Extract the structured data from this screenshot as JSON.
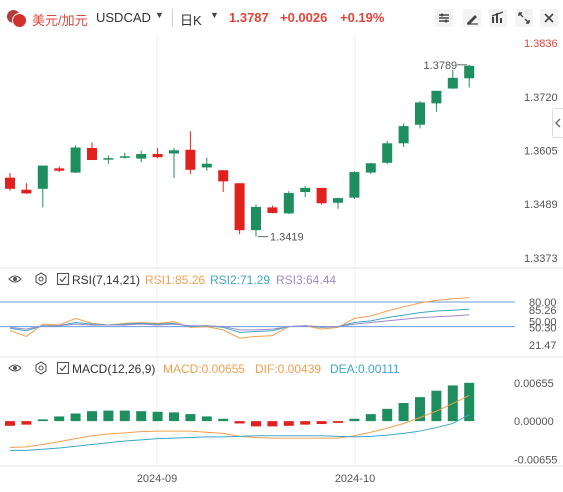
{
  "header": {
    "pair_cn": "美元/加元",
    "pair_en": "USDCAD",
    "period": "日K",
    "price": "1.3787",
    "change": "+0.0026",
    "change_pct": "+0.19%"
  },
  "colors": {
    "up": "#1e8e5e",
    "down": "#e0211e",
    "rsi1": "#f0a050",
    "rsi2": "#3aa8c8",
    "rsi3": "#a088c8",
    "dif": "#f0a050",
    "dea": "#3aa8c8"
  },
  "price_panel": {
    "y_ticks": [
      "1.3836",
      "1.3720",
      "1.3605",
      "1.3489",
      "1.3373"
    ],
    "high_label": "1.3789",
    "low_label": "1.3419"
  },
  "rsi_panel": {
    "title": "RSI(7,14,21)",
    "rsi1": "RSI1:85.26",
    "rsi2": "RSI2:71.29",
    "rsi3": "RSI3:64.44",
    "ticks": [
      "80.00",
      "85.26",
      "50.00",
      "50.30",
      "21.47"
    ]
  },
  "macd_panel": {
    "title": "MACD(12,26,9)",
    "macd": "MACD:0.00655",
    "dif": "DIF:0.00439",
    "dea": "DEA:0.00111",
    "ticks": [
      "0.00655",
      "0.00000",
      "-0.00655"
    ]
  },
  "x_axis": {
    "labels": [
      "2024-09",
      "2024-10"
    ]
  },
  "chart_data": [
    {
      "type": "candlestick",
      "title": "USDCAD 日K",
      "ylim": [
        1.3373,
        1.3836
      ],
      "ohlc": [
        [
          1.3546,
          1.3556,
          1.3518,
          1.3522
        ],
        [
          1.352,
          1.3534,
          1.3511,
          1.3512
        ],
        [
          1.3522,
          1.357,
          1.3482,
          1.3572
        ],
        [
          1.3566,
          1.357,
          1.3558,
          1.3561
        ],
        [
          1.3557,
          1.3615,
          1.3556,
          1.3611
        ],
        [
          1.361,
          1.3622,
          1.3586,
          1.3584
        ],
        [
          1.3585,
          1.3594,
          1.3576,
          1.3588
        ],
        [
          1.3589,
          1.36,
          1.3587,
          1.3592
        ],
        [
          1.3587,
          1.3604,
          1.3579,
          1.3597
        ],
        [
          1.3597,
          1.361,
          1.3588,
          1.359
        ],
        [
          1.3598,
          1.361,
          1.3545,
          1.3605
        ],
        [
          1.3606,
          1.3646,
          1.3554,
          1.3563
        ],
        [
          1.3568,
          1.3589,
          1.3561,
          1.3576
        ],
        [
          1.3562,
          1.3562,
          1.3515,
          1.3538
        ],
        [
          1.3534,
          1.3534,
          1.3424,
          1.3433
        ],
        [
          1.3433,
          1.3488,
          1.3419,
          1.3483
        ],
        [
          1.3482,
          1.3486,
          1.3469,
          1.347
        ],
        [
          1.3469,
          1.3517,
          1.3468,
          1.3513
        ],
        [
          1.3515,
          1.3528,
          1.3504,
          1.3524
        ],
        [
          1.3524,
          1.3524,
          1.3488,
          1.3491
        ],
        [
          1.3492,
          1.3503,
          1.3479,
          1.3502
        ],
        [
          1.3503,
          1.356,
          1.35,
          1.3558
        ],
        [
          1.3557,
          1.3578,
          1.3554,
          1.3577
        ],
        [
          1.3578,
          1.3625,
          1.3575,
          1.362
        ],
        [
          1.362,
          1.3663,
          1.3612,
          1.3657
        ],
        [
          1.366,
          1.3711,
          1.3652,
          1.3708
        ],
        [
          1.3706,
          1.3733,
          1.3688,
          1.3733
        ],
        [
          1.3738,
          1.3778,
          1.3737,
          1.3761
        ],
        [
          1.376,
          1.3789,
          1.374,
          1.3787
        ]
      ]
    },
    {
      "type": "line",
      "title": "RSI(7,14,21)",
      "ylim": [
        21.47,
        85.26
      ],
      "series": [
        {
          "name": "RSI1",
          "values": [
            45,
            38,
            53,
            52,
            60,
            54,
            52,
            54,
            55,
            54,
            56,
            49,
            50,
            46,
            36,
            38,
            39,
            50,
            51,
            47,
            49,
            60,
            63,
            69,
            74,
            79,
            82,
            84,
            85.26
          ]
        },
        {
          "name": "RSI2",
          "values": [
            48,
            45,
            51,
            51,
            55,
            53,
            52,
            53,
            54,
            53,
            54,
            50,
            51,
            49,
            43,
            44,
            45,
            50,
            51,
            49,
            50,
            55,
            57,
            61,
            64,
            67,
            69,
            70,
            71.29
          ]
        },
        {
          "name": "RSI3",
          "values": [
            49,
            47,
            51,
            51,
            53,
            52,
            52,
            52,
            53,
            52,
            53,
            51,
            51,
            50,
            46,
            46,
            47,
            50,
            51,
            50,
            50,
            53,
            55,
            57,
            59,
            61,
            62,
            63,
            64.44
          ]
        }
      ]
    },
    {
      "type": "bar",
      "title": "MACD(12,26,9)",
      "ylim": [
        -0.00655,
        0.00655
      ],
      "series": [
        {
          "name": "MACD",
          "values": [
            -0.0008,
            -0.0006,
            0.0003,
            0.0008,
            0.0013,
            0.0017,
            0.0018,
            0.0018,
            0.0017,
            0.0016,
            0.0015,
            0.0012,
            0.0008,
            0.0004,
            -0.0004,
            -0.0009,
            -0.0009,
            -0.0008,
            -0.0006,
            -0.0005,
            -0.0003,
            0.0004,
            0.0012,
            0.0021,
            0.0031,
            0.0041,
            0.0052,
            0.0061,
            0.00655
          ]
        },
        {
          "name": "DIF",
          "values": [
            -0.0045,
            -0.0044,
            -0.004,
            -0.0035,
            -0.003,
            -0.0025,
            -0.0022,
            -0.002,
            -0.0018,
            -0.0017,
            -0.0017,
            -0.0017,
            -0.0019,
            -0.0021,
            -0.0026,
            -0.0028,
            -0.0029,
            -0.0029,
            -0.0029,
            -0.0029,
            -0.0029,
            -0.0025,
            -0.0019,
            -0.0012,
            -0.0004,
            0.0006,
            0.0017,
            0.003,
            0.00439
          ]
        },
        {
          "name": "DEA",
          "values": [
            -0.005,
            -0.005,
            -0.0048,
            -0.0046,
            -0.0043,
            -0.004,
            -0.0037,
            -0.0034,
            -0.0032,
            -0.003,
            -0.0029,
            -0.0028,
            -0.0027,
            -0.0027,
            -0.0026,
            -0.0025,
            -0.0025,
            -0.0025,
            -0.0025,
            -0.0025,
            -0.0026,
            -0.0027,
            -0.0026,
            -0.0024,
            -0.0021,
            -0.0017,
            -0.0011,
            -0.0004,
            0.00111
          ]
        }
      ]
    }
  ]
}
